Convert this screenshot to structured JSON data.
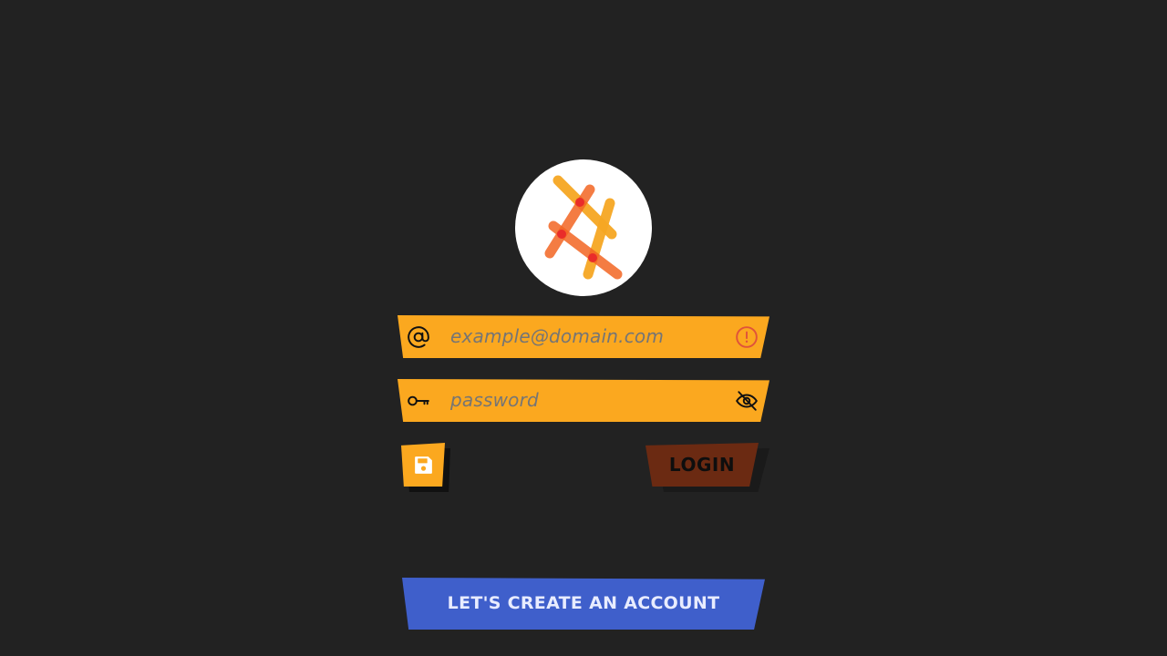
{
  "logo": {
    "icon": "crossed-sticks-logo-icon",
    "colors": {
      "orange": "#f5a623",
      "red_orange": "#f26522",
      "overlap": "#e8262b"
    }
  },
  "email": {
    "lead_icon": "at-sign-icon",
    "placeholder": "example@domain.com",
    "value": "",
    "trail_icon": "alert-circle-icon",
    "trail_color": "#e0533a"
  },
  "password": {
    "lead_icon": "key-icon",
    "placeholder": "password",
    "value": "",
    "trail_icon": "eye-off-icon"
  },
  "actions": {
    "save_icon": "floppy-disk-icon",
    "login_label": "LOGIN",
    "create_label": "LET'S CREATE AN ACCOUNT"
  },
  "colors": {
    "background": "#222222",
    "field": "#fba81f",
    "login": "#6b2a12",
    "create": "#3f5fcb"
  }
}
